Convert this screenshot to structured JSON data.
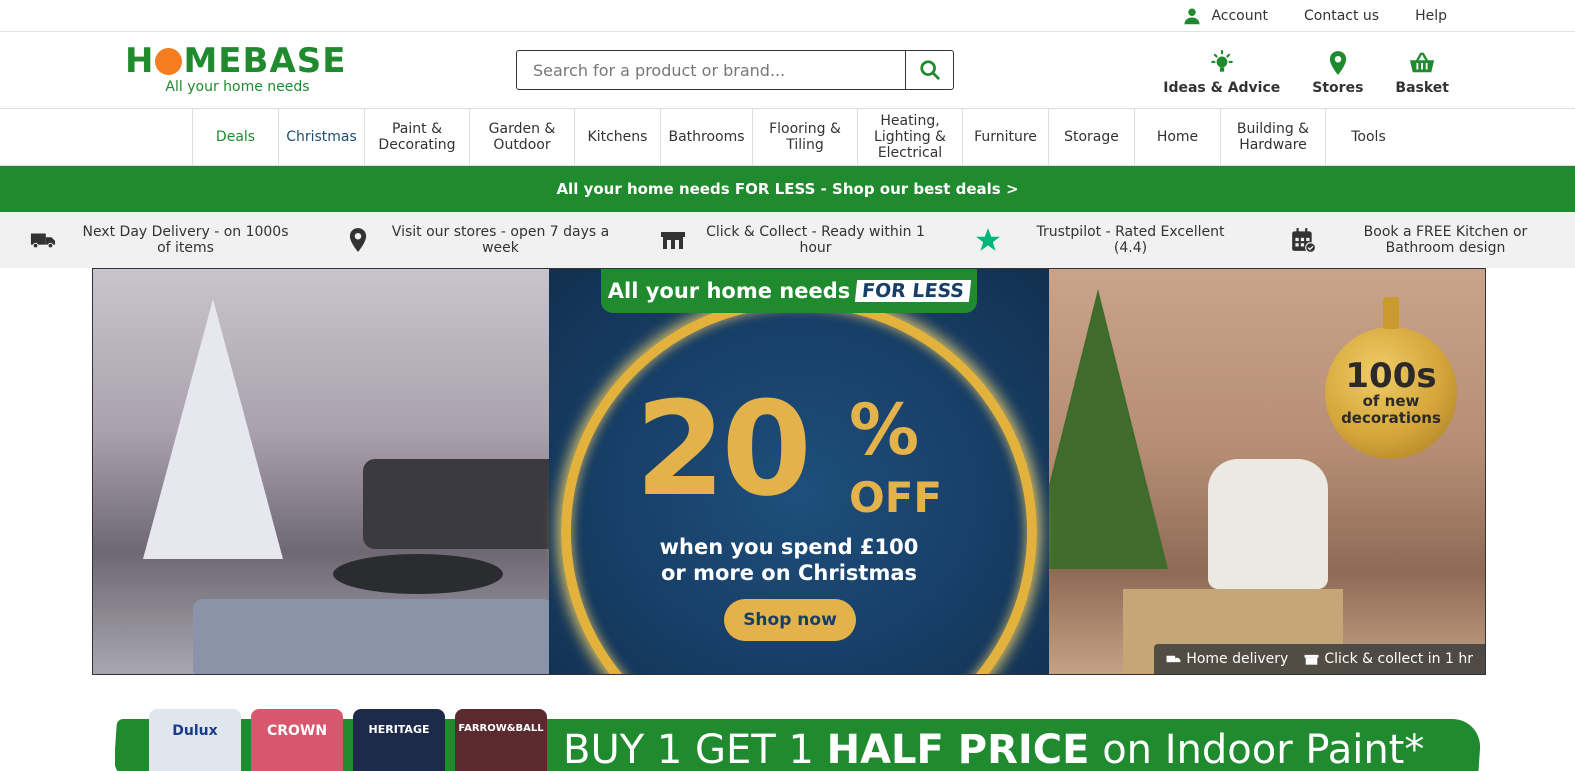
{
  "util": {
    "account": "Account",
    "contact": "Contact us",
    "help": "Help"
  },
  "brand": {
    "name_h": "H",
    "name_rest": "MEBASE",
    "tagline": "All your home needs",
    "green": "#1f8a2e",
    "orange": "#f57c1f"
  },
  "search": {
    "placeholder": "Search for a product or brand..."
  },
  "header_icons": {
    "ideas": "Ideas & Advice",
    "stores": "Stores",
    "basket": "Basket"
  },
  "nav": [
    "Deals",
    "Christmas",
    "Paint &\nDecorating",
    "Garden &\nOutdoor",
    "Kitchens",
    "Bathrooms",
    "Flooring &\nTiling",
    "Heating,\nLighting &\nElectrical",
    "Furniture",
    "Storage",
    "Home",
    "Building &\nHardware",
    "Tools"
  ],
  "promo_bar": "All your home needs FOR LESS - Shop our best deals >",
  "usps": [
    "Next Day Delivery - on 1000s of items",
    "Visit our stores - open 7 days a week",
    "Click & Collect - Ready within 1 hour",
    "Trustpilot - Rated Excellent (4.4)",
    "Book a FREE Kitchen or Bathroom design"
  ],
  "hero": {
    "banner_text": "All your home needs",
    "banner_highlight": "FOR LESS",
    "big_number": "20",
    "percent": "%",
    "off": "OFF",
    "sub_line1": "when you spend £100",
    "sub_line2": "or more on Christmas",
    "cta": "Shop now",
    "bauble_line1": "100s",
    "bauble_line2": "of new",
    "bauble_line3": "decorations",
    "home_delivery": "Home delivery",
    "click_collect": "Click & collect in 1 hr"
  },
  "paint_banner": {
    "cans": [
      "Dulux",
      "CROWN",
      "HERITAGE",
      "FARROW&BALL"
    ],
    "text_start": "BUY 1 GET 1 ",
    "text_bold": "HALF PRICE",
    "text_end": " on Indoor Paint*"
  }
}
